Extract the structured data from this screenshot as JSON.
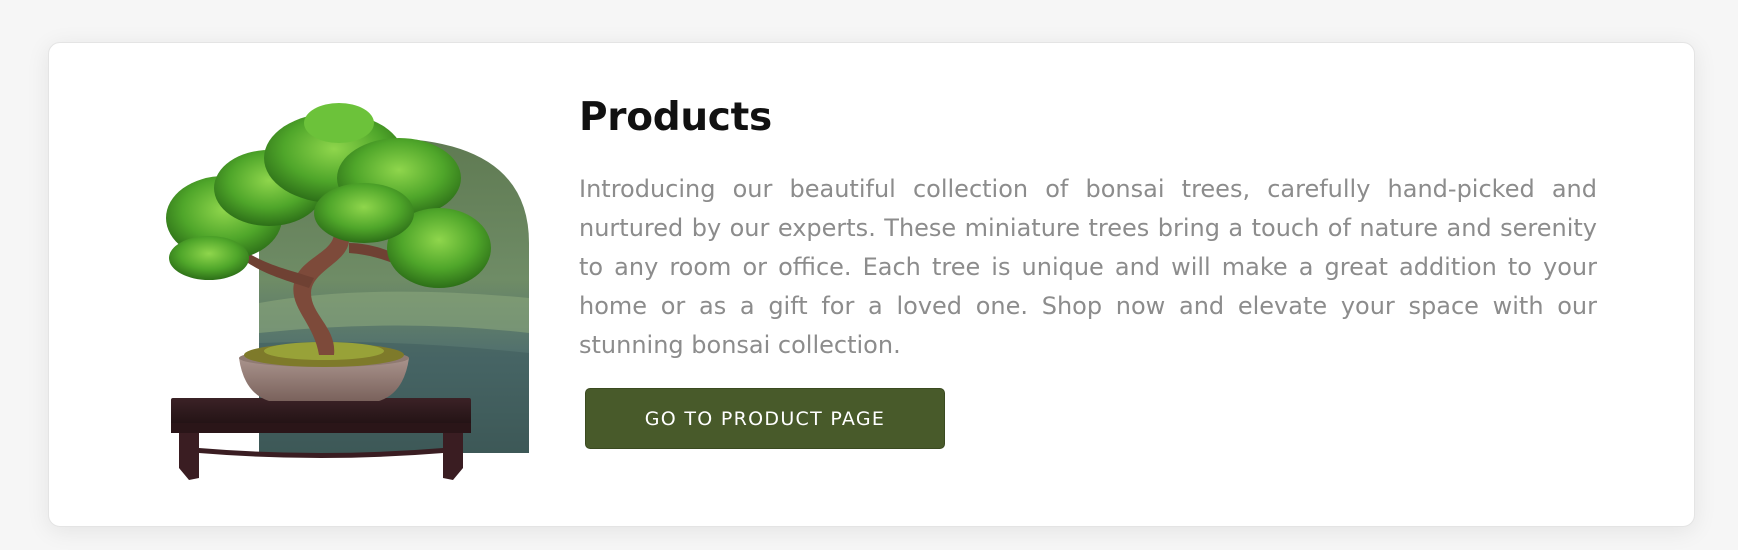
{
  "product_section": {
    "title": "Products",
    "description": "Introducing our beautiful collection of bonsai trees, carefully hand-picked and nurtured by our experts. These miniature trees bring a touch of nature and serenity to any room or office. Each tree is unique and will make a great addition to your home or as a gift for a loved one. Shop now and elevate your space with our stunning bonsai collection.",
    "cta_label": "GO TO PRODUCT PAGE",
    "image_icon": "bonsai-tree-image"
  },
  "colors": {
    "button_bg": "#485a2a",
    "title_text": "#111111",
    "body_text": "#8c8c8c",
    "card_bg": "#ffffff",
    "page_bg": "#f6f6f6"
  }
}
